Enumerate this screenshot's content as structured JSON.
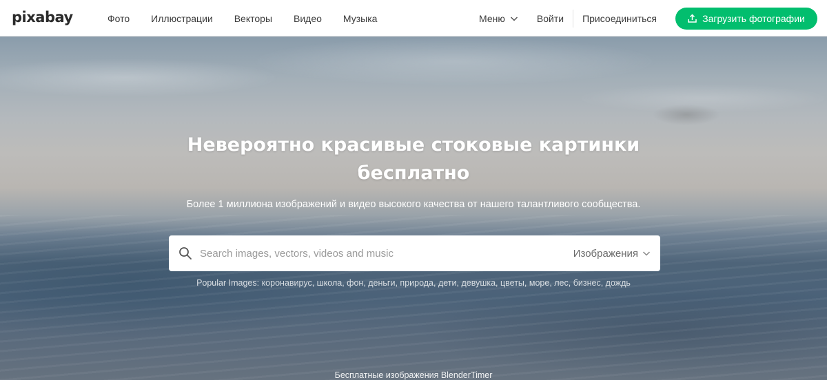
{
  "header": {
    "logo": "pixabay",
    "nav": [
      "Фото",
      "Иллюстрации",
      "Векторы",
      "Видео",
      "Музыка"
    ],
    "menu_label": "Меню",
    "login_label": "Войти",
    "join_label": "Присоединиться",
    "upload_label": "Загрузить фотографии"
  },
  "hero": {
    "title_line1": "Невероятно красивые стоковые картинки",
    "title_line2": "бесплатно",
    "subtitle": "Более 1 миллиона изображений и видео высокого качества от нашего талантливого сообщества.",
    "search": {
      "placeholder": "Search images, vectors, videos and music",
      "type_selected": "Изображения"
    },
    "popular_label": "Popular Images:",
    "popular_tags": [
      "коронавирус",
      "школа",
      "фон",
      "деньги",
      "природа",
      "дети",
      "девушка",
      "цветы",
      "море",
      "лес",
      "бизнес",
      "дождь"
    ],
    "credit": "Бесплатные изображения BlenderTimer"
  },
  "colors": {
    "accent": "#02be6e",
    "nav_text": "#3b3b3b"
  }
}
